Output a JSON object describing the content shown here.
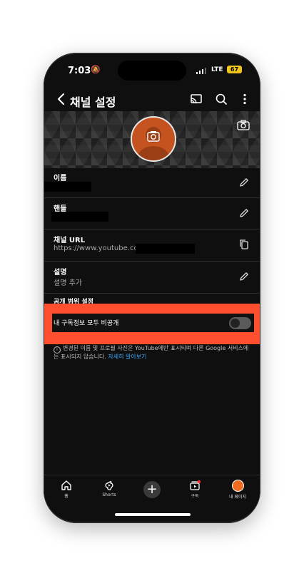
{
  "status": {
    "time": "7:03",
    "network": "LTE",
    "battery": "67"
  },
  "header": {
    "title": "채널 설정"
  },
  "fields": [
    {
      "label": "이름"
    },
    {
      "label": "핸들"
    },
    {
      "label": "채널 URL",
      "value": "https://www.youtube.co"
    },
    {
      "label": "설명",
      "value": "설명 추가"
    }
  ],
  "privacy": {
    "section_title": "공개 범위 설정",
    "toggle_label": "내 구독정보 모두 비공개",
    "toggle_on": false
  },
  "notice": {
    "text": "변경된 이름 및 프로필 사진은 YouTube에만 표시되며 다른 Google 서비스에는 표시되지 않습니다.",
    "link": "자세히 알아보기"
  },
  "nav": {
    "home": "홈",
    "shorts": "Shorts",
    "subscriptions": "구독",
    "me": "내 페이지"
  },
  "colors": {
    "highlight": "#ff4f2f",
    "link": "#3ea6ff",
    "avatar": "#c4531f"
  }
}
